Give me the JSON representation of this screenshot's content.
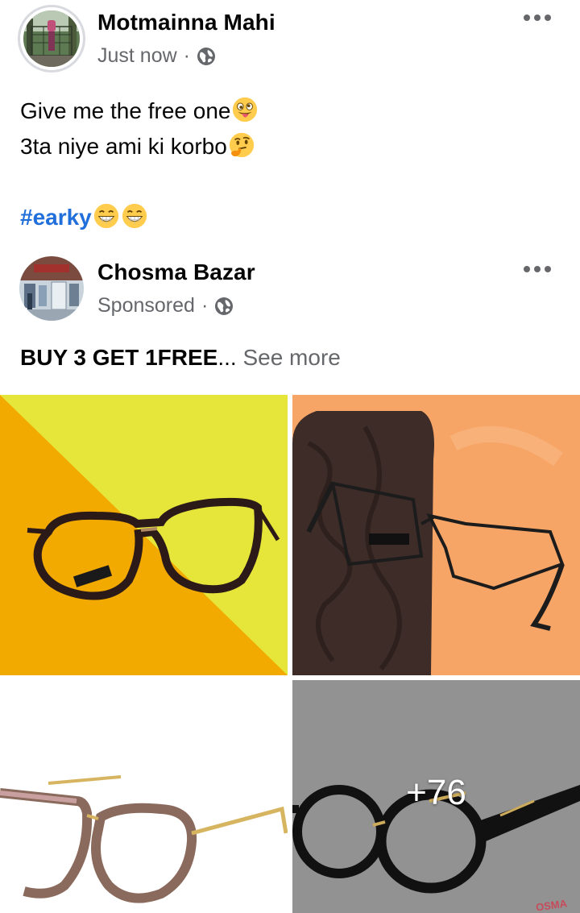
{
  "shared_post": {
    "author": "Motmainna Mahi",
    "timestamp": "Just now",
    "separator": "·",
    "privacy_icon": "globe-icon",
    "lines": [
      "Give me the free one",
      "3ta niye ami ki korbo"
    ],
    "hashtag": "#earky"
  },
  "ad_post": {
    "page_name": "Chosma Bazar",
    "label": "Sponsored",
    "separator": "·",
    "privacy_icon": "globe-icon",
    "headline": "BUY 3 GET 1FREE",
    "ellipsis": "...",
    "see_more": "See more"
  },
  "gallery": {
    "tiles": [
      {
        "name": "yellow-frame-glasses",
        "background": "#f2a900"
      },
      {
        "name": "wire-frame-glasses-on-wallet",
        "background": "#f7a566"
      },
      {
        "name": "tortoise-frame-glasses",
        "background": "#ffffff"
      },
      {
        "name": "round-black-glasses",
        "background": "#9a9a9a"
      }
    ],
    "more_count": "+76",
    "watermark": "OSMA"
  },
  "colors": {
    "text": "#050505",
    "secondary": "#65676b",
    "hashtag": "#216fdb"
  }
}
